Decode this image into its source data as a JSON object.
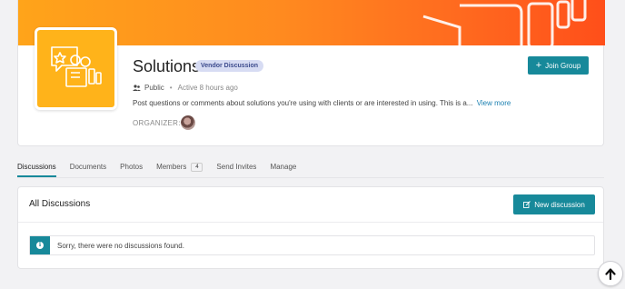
{
  "group": {
    "title": "Solutions",
    "badge": "Vendor Discussion",
    "join_label": "Join Group",
    "privacy": "Public",
    "active": "Active 8 hours ago",
    "description": "Post questions or comments about solutions you're using with clients or are interested in using. This is a...",
    "view_more": "View more",
    "organizer_label": "ORGANIZER:"
  },
  "tabs": [
    {
      "label": "Discussions",
      "active": true
    },
    {
      "label": "Documents"
    },
    {
      "label": "Photos"
    },
    {
      "label": "Members",
      "count": "4"
    },
    {
      "label": "Send Invites"
    },
    {
      "label": "Manage"
    }
  ],
  "discussions": {
    "title": "All Discussions",
    "new_label": "New discussion",
    "empty_message": "Sorry, there were no discussions found."
  },
  "colors": {
    "accent": "#17899a",
    "banner_orange": "#ff8a1f",
    "logo_yellow": "#ffb31a",
    "badge_bg": "#d7dcf3"
  },
  "icons": {
    "join": "plus-icon",
    "privacy": "people-icon",
    "new_discussion": "edit-icon",
    "alert": "info-icon",
    "scroll": "arrow-up-icon"
  }
}
